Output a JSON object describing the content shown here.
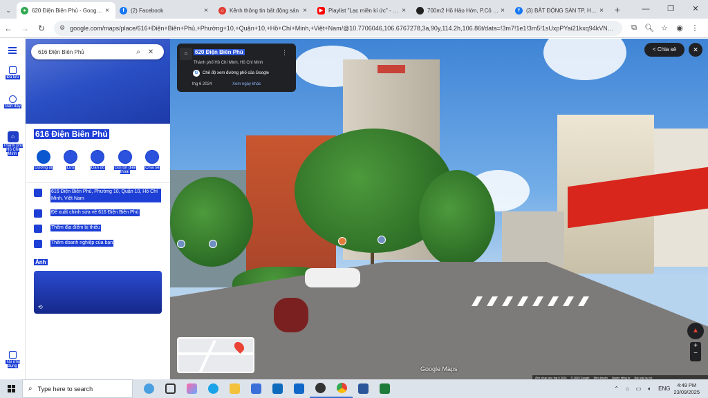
{
  "browser": {
    "tabs": [
      {
        "title": "620 Điện Biên Phủ - Google M",
        "icon_color": "#34a853",
        "icon": "maps-icon",
        "active": true
      },
      {
        "title": "(2) Facebook",
        "icon_color": "#1877f2",
        "icon": "facebook-icon",
        "active": false
      },
      {
        "title": "Kênh thông tin bất động sản",
        "icon_color": "#e03c31",
        "icon": "batdongsan-icon",
        "active": false
      },
      {
        "title": "Playlist \"Lạc miền kí ức\" - You",
        "icon_color": "#ff0000",
        "icon": "youtube-icon",
        "active": false
      },
      {
        "title": "700m2 Hồ Hảo Hớn, P.Cô Gia",
        "icon_color": "#222222",
        "icon": "site-icon",
        "active": false
      },
      {
        "title": "(3) BẤT ĐỘNG SẢN TP. HỒ C",
        "icon_color": "#1877f2",
        "icon": "facebook-icon",
        "active": false
      }
    ],
    "new_tab": "+",
    "url": "google.com/maps/place/616+Điện+Biên+Phủ,+Phường+10,+Quận+10,+Hồ+Chí+Minh,+Việt+Nam/@10.7706046,106.6767278,3a,90y,114.2h,106.86t/data=!3m7!1e1!3m5!1sUxpPYai21kxq94kVNDdjw..."
  },
  "rail": {
    "saved": "Đã lưu",
    "recent": "Gần đây",
    "city": "Thành phố Hồ Chí Minh",
    "apps": "Tải ứng dụng"
  },
  "panel": {
    "search_value": "616 Điện Biên Phủ",
    "title": "616 Điện Biên Phủ",
    "actions": [
      {
        "label": "Đường đi",
        "name": "directions"
      },
      {
        "label": "Lưu",
        "name": "save"
      },
      {
        "label": "Gần đó",
        "name": "nearby"
      },
      {
        "label": "Gửi tới điện thoại",
        "name": "send-to-phone"
      },
      {
        "label": "Chia sẻ",
        "name": "share"
      }
    ],
    "address": "616 Điện Biên Phủ, Phường 10, Quận 10, Hồ Chí Minh, Việt Nam",
    "suggest_edit": "Đề xuất chỉnh sửa về 616 Điện Biên Phủ",
    "add_missing": "Thêm địa điểm bị thiếu",
    "add_business": "Thêm doanh nghiệp của bạn",
    "photos_label": "Ảnh"
  },
  "streetview": {
    "address": "620 Điện Biên Phủ",
    "city": "Thành phố Hồ Chí Minh, Hồ Chí Minh",
    "toggle_label": "Chế độ xem đường phố của Google",
    "date": "thg 6 2024",
    "other_dates": "Xem ngày khác",
    "share": "Chia sẻ",
    "brand": "Google Maps",
    "footer": [
      "Ảnh chụp vào: thg 6 2024",
      "© 2025 Google",
      "Điều khoản",
      "Quyền riêng tư",
      "Báo cáo sự cố"
    ],
    "zoom_in": "+",
    "zoom_out": "−"
  },
  "taskbar": {
    "search_placeholder": "Type here to search",
    "lang": "ENG",
    "time": "4:49 PM",
    "date": "23/09/2025"
  }
}
